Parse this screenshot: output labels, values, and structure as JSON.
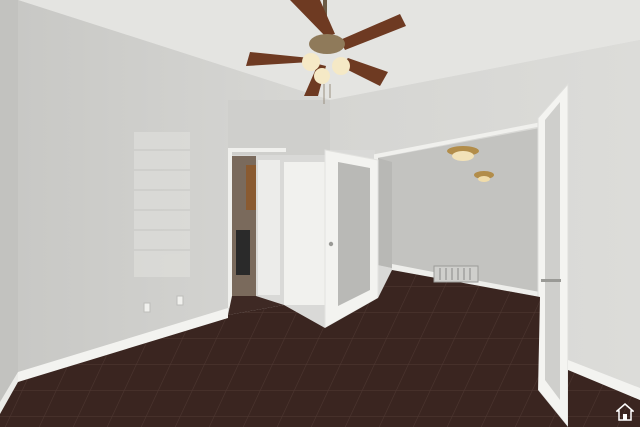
{
  "scene": {
    "description_visible_text": "",
    "colors": {
      "wall_left": "#d4d4d1",
      "wall_back": "#c9c9c6",
      "wall_right": "#d8d8d5",
      "ceiling": "#e6e6e3",
      "floor_tile": "#3a2520",
      "grout": "#5a4540",
      "baseboard": "#f2f2ef",
      "door": "#efefec",
      "fan_blade": "#6b3a24",
      "fan_light": "#f4e6c0"
    },
    "icons": {
      "ceiling_fan": "ceiling-fan-icon",
      "light_fixture": "ceiling-light-icon",
      "floor_vent": "floor-vent-icon",
      "outlet": "outlet-icon",
      "watermark": "house-logo-icon"
    }
  }
}
